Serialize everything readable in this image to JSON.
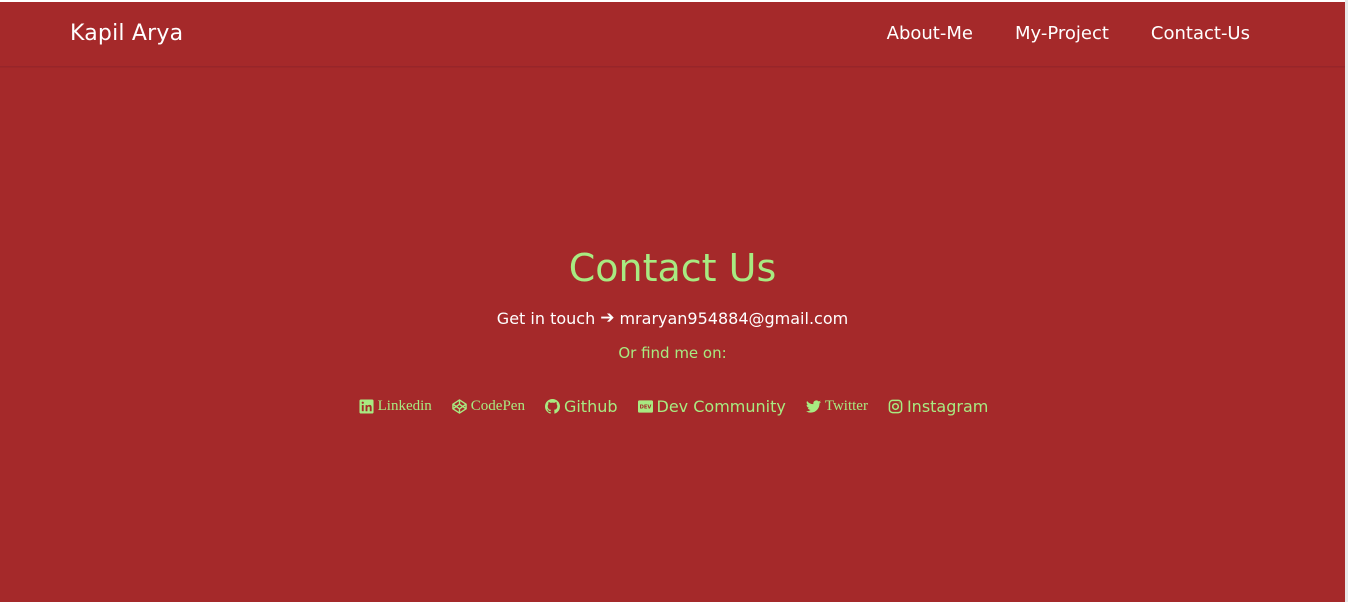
{
  "navbar": {
    "brand": "Kapil Arya",
    "links": [
      "About-Me",
      "My-Project",
      "Contact-Us"
    ]
  },
  "contact": {
    "title": "Contact Us",
    "touch_text": "Get in touch",
    "email": "mraryan954884@gmail.com",
    "find_text": "Or find me on:",
    "socials": [
      {
        "label": "Linkedin",
        "icon": "linkedin-icon"
      },
      {
        "label": "CodePen",
        "icon": "codepen-icon"
      },
      {
        "label": "Github",
        "icon": "github-icon"
      },
      {
        "label": "Dev Community",
        "icon": "dev-icon"
      },
      {
        "label": "Twitter",
        "icon": "twitter-icon"
      },
      {
        "label": "Instagram",
        "icon": "instagram-icon"
      }
    ]
  },
  "colors": {
    "background": "#a5292a",
    "accent": "#a8ea81",
    "text": "#ffffff"
  }
}
